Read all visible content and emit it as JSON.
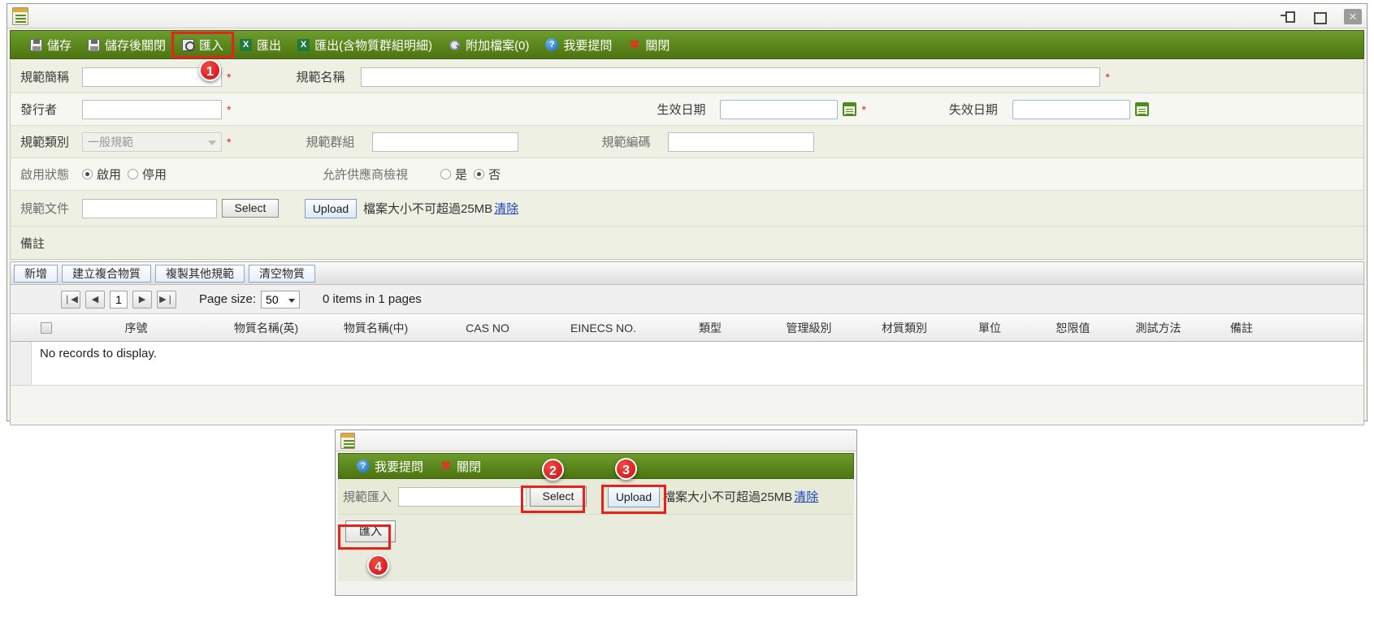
{
  "window": {
    "icon": "document-icon",
    "controls": [
      {
        "name": "restore-down-button",
        "glyph": ""
      },
      {
        "name": "maximize-button",
        "glyph": ""
      },
      {
        "name": "close-button",
        "glyph": "✕"
      }
    ]
  },
  "toolbar": {
    "items": [
      {
        "label": "儲存",
        "icon": "save-icon"
      },
      {
        "label": "儲存後關閉",
        "icon": "save-close-icon"
      },
      {
        "label": "匯入",
        "icon": "import-icon"
      },
      {
        "label": "匯出",
        "icon": "excel-export-icon"
      },
      {
        "label": "匯出(含物質群組明細)",
        "icon": "excel-export-detail-icon"
      },
      {
        "label": "附加檔案(0)",
        "icon": "magnifier-icon"
      },
      {
        "label": "我要提問",
        "icon": "question-icon"
      },
      {
        "label": "關閉",
        "icon": "close-x-icon"
      }
    ],
    "excel_glyph": "X"
  },
  "form": {
    "spec_short_name_label": "規範簡稱",
    "spec_short_name_value": "",
    "spec_name_label": "規範名稱",
    "spec_name_value": "",
    "issuer_label": "發行者",
    "issuer_value": "",
    "effective_date_label": "生效日期",
    "effective_date_value": "",
    "expiry_date_label": "失效日期",
    "expiry_date_value": "",
    "spec_category_label": "規範類別",
    "spec_category_value": "一般規範",
    "spec_group_label": "規範群組",
    "spec_group_value": "",
    "spec_code_label": "規範編碼",
    "spec_code_value": "",
    "status_label": "啟用狀態",
    "status_enabled": "啟用",
    "status_disabled": "停用",
    "supplier_view_label": "允許供應商檢視",
    "supplier_yes": "是",
    "supplier_no": "否",
    "spec_file_label": "規範文件",
    "spec_file_value": "",
    "select_button": "Select",
    "upload_button": "Upload",
    "size_hint": "檔案大小不可超過25MB",
    "clear_link": "清除",
    "remark_label": "備註",
    "required_mark": "*"
  },
  "grid_toolbar": {
    "buttons": [
      "新增",
      "建立複合物質",
      "複製其他規範",
      "清空物質"
    ]
  },
  "pager": {
    "first": "❘◀",
    "prev": "◀",
    "current_page": "1",
    "next": "▶",
    "last": "▶❘",
    "page_size_label": "Page size:",
    "page_size_value": "50",
    "info": "0 items in 1 pages"
  },
  "table": {
    "columns": [
      "序號",
      "物質名稱(英)",
      "物質名稱(中)",
      "CAS NO",
      "EINECS NO.",
      "類型",
      "管理級別",
      "材質類別",
      "單位",
      "恕限值",
      "測試方法",
      "備註"
    ],
    "empty_text": "No records to display."
  },
  "dialog": {
    "toolbar": [
      {
        "label": "我要提問",
        "icon": "question-icon"
      },
      {
        "label": "關閉",
        "icon": "close-x-icon"
      }
    ],
    "import_label": "規範匯入",
    "import_value": "",
    "select_button": "Select",
    "upload_button": "Upload",
    "size_hint": "檔案大小不可超過25MB",
    "clear_link": "清除",
    "import_button": "匯入"
  },
  "annotations": {
    "badges": [
      "1",
      "2",
      "3",
      "4"
    ]
  },
  "colors": {
    "toolbar_green": "#5d8a1e",
    "annotation_red": "#e8211a",
    "link_blue": "#1a43c8",
    "row_alt": "#eef0e3"
  }
}
